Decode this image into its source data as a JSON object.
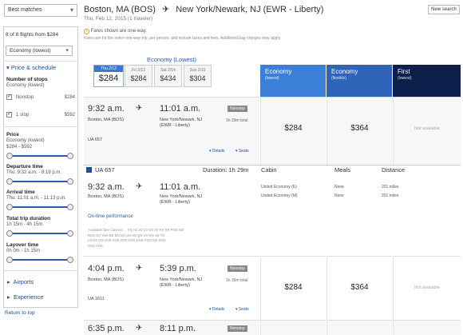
{
  "sidebar": {
    "sort_value": "Best matches",
    "flight_count": "8 of 8 flights from $284",
    "cabin_value": "Economy (lowest)",
    "price_schedule_heading": "Price & schedule",
    "stops": {
      "title": "Number of stops",
      "subtitle": "Economy (lowest)",
      "options": [
        {
          "label": "Nonstop",
          "price": "$284",
          "checked": true
        },
        {
          "label": "1 stop",
          "price": "$592",
          "checked": true
        }
      ]
    },
    "price_filter": {
      "title": "Price",
      "sub": "Economy (lowest)",
      "range": "$284 - $592"
    },
    "departure_filter": {
      "title": "Departure time",
      "range": "Thu. 9:32 a.m. - 8:19 p.m."
    },
    "arrival_filter": {
      "title": "Arrival time",
      "range": "Thu. 11:01 a.m. - 11:13 p.m."
    },
    "duration_filter": {
      "title": "Total trip duration",
      "range": "1h 15m - 4h 15m"
    },
    "layover_filter": {
      "title": "Layover time",
      "range": "0h 0m - 1h 15m"
    },
    "airports_label": "Airports",
    "experience_label": "Experience",
    "return_to_top": "Return to top"
  },
  "header": {
    "origin": "Boston, MA (BOS)",
    "destination": "New York/Newark, NJ (EWR - Liberty)",
    "subline": "Thu, Feb 12, 2015 (1 traveler)",
    "new_search": "New search",
    "notice_line1": "Fares shown are one-way.",
    "notice_line2": "Fares are for the entire one-way trip, per person, and include taxes and fees. Additional bag charges may apply."
  },
  "date_strip": {
    "cabin_title": "Economy (Lowest)",
    "dates": [
      {
        "date": "Thu 2/12",
        "price": "$284",
        "active": true
      },
      {
        "date": "Fri 2/13",
        "price": "$284",
        "active": false
      },
      {
        "date": "Sat 2/14",
        "price": "$434",
        "active": false
      },
      {
        "date": "Sun 2/15",
        "price": "$304",
        "active": false
      }
    ]
  },
  "fare_columns": [
    {
      "name": "Economy",
      "sub": "(lowest)",
      "color": "#3b7fd8"
    },
    {
      "name": "Economy",
      "sub": "(flexible)",
      "color": "#2f64b8"
    },
    {
      "name": "First",
      "sub": "(lowest)",
      "color": "#0c1f4a"
    }
  ],
  "flights": [
    {
      "depart": "9:32 a.m.",
      "arrive": "11:01 a.m.",
      "origin": "Boston, MA (BOS)",
      "dest_line1": "New York/Newark, NJ",
      "dest_line2": "(EWR - Liberty)",
      "badge": "Nonstop",
      "duration": "1h 29m total",
      "flight_no": "UA 657",
      "details": "▾ Details",
      "seats": "▾ Seats",
      "price_economy": "$284",
      "price_flex": "$364",
      "price_first": "Not available"
    },
    {
      "depart": "4:04 p.m.",
      "arrive": "5:39 p.m.",
      "origin": "Boston, MA (BOS)",
      "dest_line1": "New York/Newark, NJ",
      "dest_line2": "(EWR - Liberty)",
      "badge": "Nonstop",
      "duration": "1h 35m total",
      "flight_no": "UA 1611",
      "details": "▾ Details",
      "seats": "▾ Seats",
      "price_economy": "$284",
      "price_flex": "$364",
      "price_first": "Not available"
    },
    {
      "depart": "6:35 p.m.",
      "arrive": "8:11 p.m.",
      "badge": "Nonstop"
    }
  ],
  "details_panel": {
    "flight_no": "UA 657",
    "duration": "Duration: 1h 29m",
    "col_cabin": "Cabin",
    "col_meals": "Meals",
    "col_distance": "Distance",
    "depart": "9:32 a.m.",
    "arrive": "11:01 a.m.",
    "origin": "Boston, MA (BOS)",
    "dest_line1": "New York/Newark, NJ",
    "dest_line2": "(EWR - Liberty)",
    "cabin_rows": [
      {
        "cabin": "United Economy (E)",
        "meals": "None",
        "distance": "201 miles"
      },
      {
        "cabin": "United Economy (M)",
        "meals": "None",
        "distance": "201 miles"
      }
    ],
    "on_time": "On-time performance",
    "fare_classes_label": "Available fare classes:",
    "fare_classes_line1": "P3 A0 J0 C0 D0 Z0 P0 R9 PN0 IN0",
    "fare_classes_line2": "RN0 S0 YN9 B9 M9 E9 U9 H9 Q9 V9 W9 S9 T9",
    "fare_classes_line3": "L9 K9 G9 UN9 XN9 ZN9 NR0 DN9 PZ0 IN0 RN0",
    "fare_classes_line4": "SN0 YN9"
  }
}
